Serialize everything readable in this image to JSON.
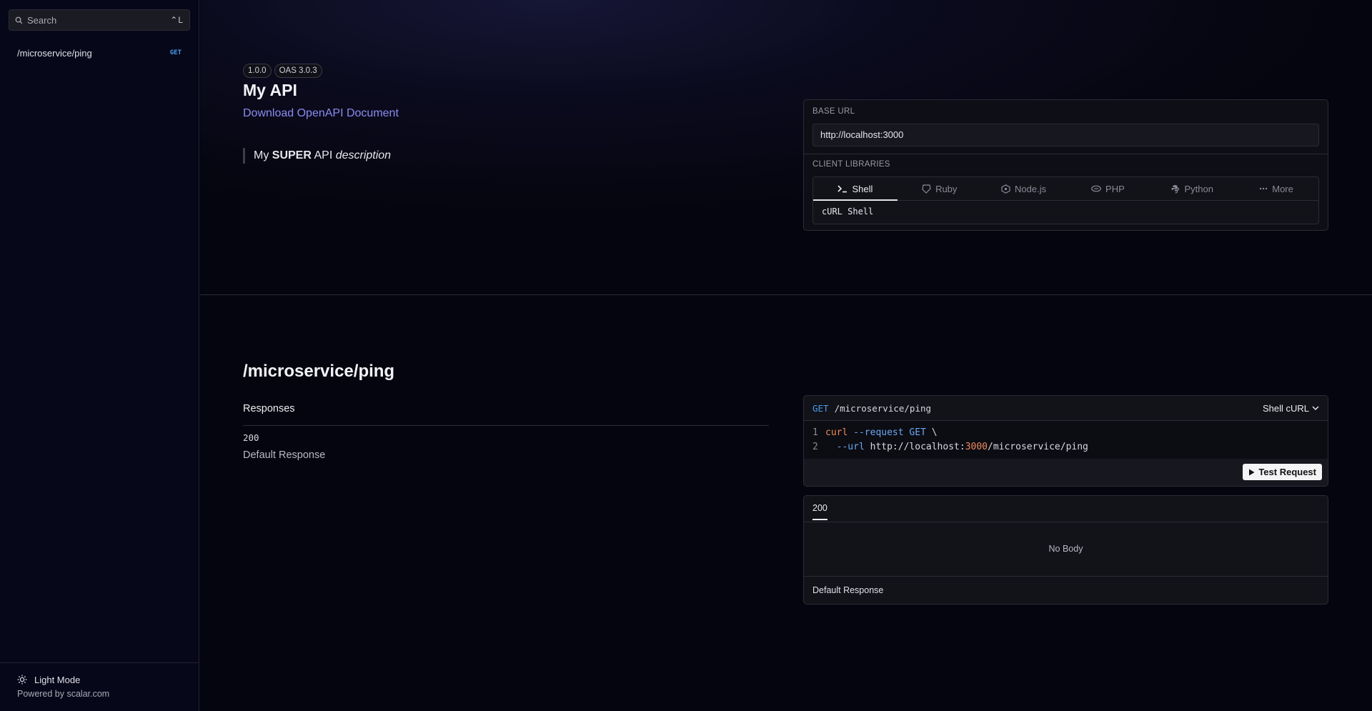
{
  "sidebar": {
    "search_placeholder": "Search",
    "search_shortcut": "⌃L",
    "nav_items": [
      {
        "label": "/microservice/ping",
        "method": "GET"
      }
    ],
    "light_mode_label": "Light Mode",
    "powered_by": "Powered by scalar.com"
  },
  "intro": {
    "version_badge": "1.0.0",
    "oas_badge": "OAS 3.0.3",
    "title": "My API",
    "download_link": "Download OpenAPI Document",
    "description": {
      "prefix": "My ",
      "bold": "SUPER",
      "middle": " API ",
      "italic": "description"
    }
  },
  "client_card": {
    "base_url_label": "BASE URL",
    "base_url_value": "http://localhost:3000",
    "client_libraries_label": "CLIENT LIBRARIES",
    "tabs": [
      {
        "label": "Shell",
        "icon": "terminal-icon",
        "active": true
      },
      {
        "label": "Ruby",
        "icon": "ruby-icon",
        "active": false
      },
      {
        "label": "Node.js",
        "icon": "nodejs-icon",
        "active": false
      },
      {
        "label": "PHP",
        "icon": "php-icon",
        "active": false
      },
      {
        "label": "Python",
        "icon": "python-icon",
        "active": false
      },
      {
        "label": "More",
        "icon": "ellipsis-icon",
        "active": false
      }
    ],
    "variant": "cURL Shell"
  },
  "endpoint": {
    "title": "/microservice/ping",
    "responses_label": "Responses",
    "response_code": "200",
    "response_description": "Default Response"
  },
  "request_card": {
    "method": "GET",
    "path": "/microservice/ping",
    "language": "Shell cURL",
    "code_lines": [
      {
        "n": "1",
        "parts": [
          [
            "cmd",
            "curl"
          ],
          [
            "str",
            " "
          ],
          [
            "flag",
            "--request"
          ],
          [
            "str",
            " "
          ],
          [
            "flag",
            "GET"
          ],
          [
            "str",
            " \\"
          ]
        ]
      },
      {
        "n": "2",
        "parts": [
          [
            "str",
            "  "
          ],
          [
            "flag",
            "--url"
          ],
          [
            "str",
            " http://localhost:"
          ],
          [
            "num",
            "3000"
          ],
          [
            "str",
            "/microservice/ping"
          ]
        ]
      }
    ],
    "test_button": "Test Request"
  },
  "response_card": {
    "tab": "200",
    "body": "No Body",
    "description": "Default Response"
  },
  "colors": {
    "accent_link": "#8a8cf0",
    "method_get": "#4a9ce8",
    "code_keyword": "#f08a5d"
  }
}
